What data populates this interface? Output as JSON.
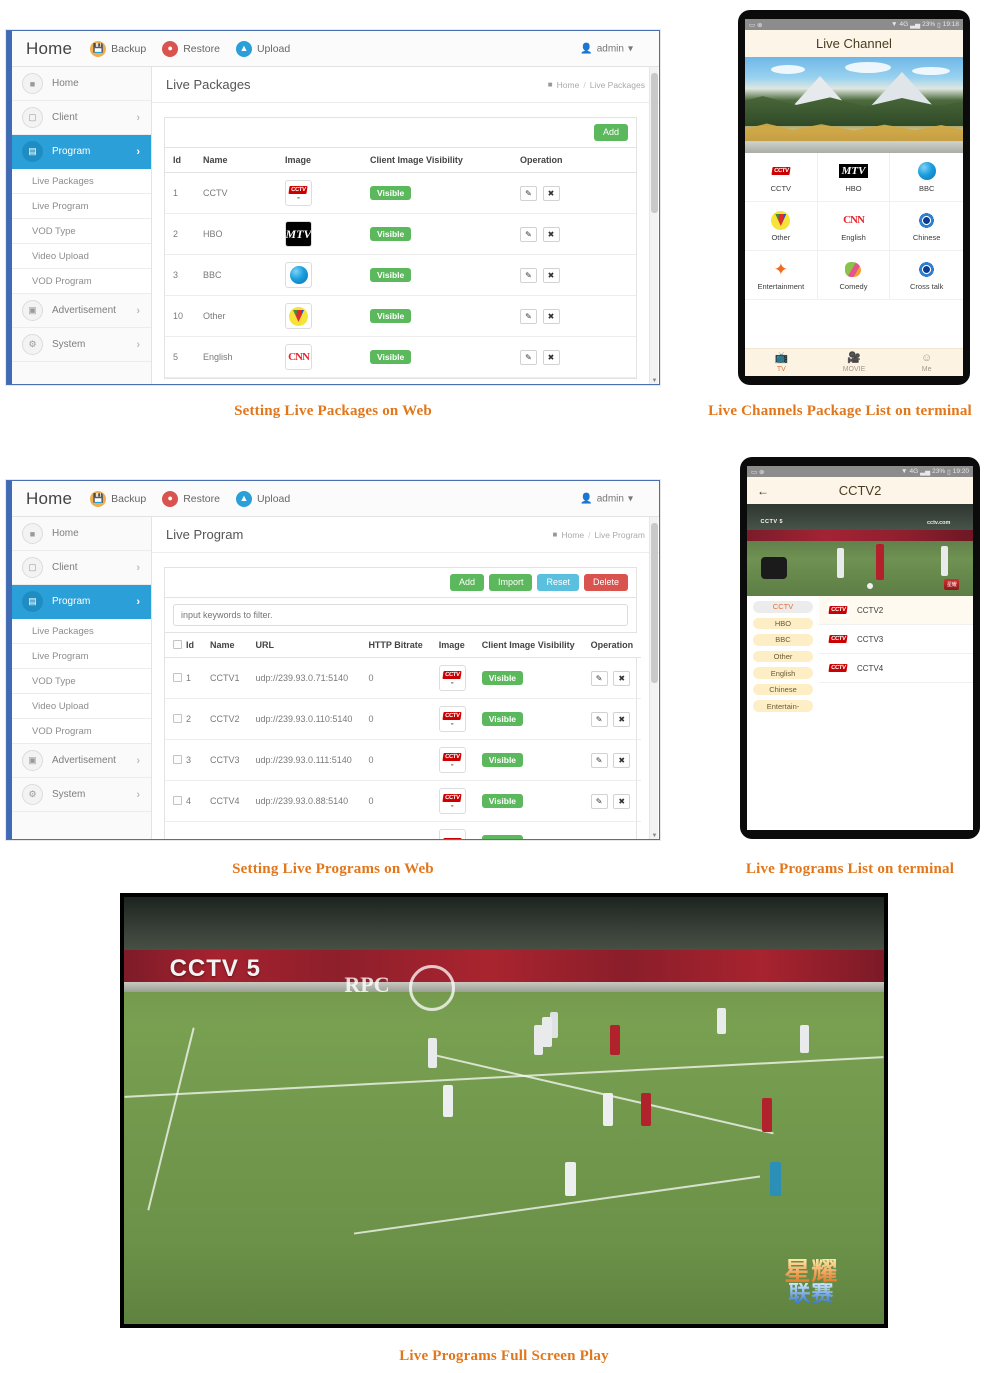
{
  "page": {
    "captions": {
      "fig1": "Setting Live Packages on Web",
      "fig2": "Live Channels Package List on terminal",
      "fig3": "Setting Live Programs on Web",
      "fig4": "Live Programs List on terminal",
      "fig5": "Live Programs Full Screen Play"
    },
    "accent_orange": "#E2761B"
  },
  "web": {
    "topbar": {
      "brand": "Home",
      "backup": "Backup",
      "restore": "Restore",
      "upload": "Upload",
      "user": "admin",
      "caret": "▾"
    },
    "sidebar": {
      "items": [
        {
          "label": "Home",
          "icon": "home-icon",
          "chevron": ""
        },
        {
          "label": "Client",
          "icon": "monitor-icon",
          "chevron": "›"
        },
        {
          "label": "Program",
          "icon": "database-icon",
          "chevron": "›"
        }
      ],
      "subitems": [
        "Live Packages",
        "Live Program",
        "VOD Type",
        "Video Upload",
        "VOD Program"
      ],
      "bottom": [
        {
          "label": "Advertisement",
          "icon": "image-icon",
          "chevron": "›"
        },
        {
          "label": "System",
          "icon": "gear-icon",
          "chevron": "›"
        }
      ]
    },
    "panel1": {
      "title": "Live Packages",
      "breadcrumb": {
        "home": "Home",
        "sep": "/",
        "current": "Live Packages"
      },
      "add_label": "Add",
      "columns": [
        "Id",
        "Name",
        "Image",
        "Client Image Visibility",
        "Operation"
      ],
      "rows": [
        {
          "id": "1",
          "name": "CCTV",
          "logo": "cctv-logo",
          "visibility": "Visible"
        },
        {
          "id": "2",
          "name": "HBO",
          "logo": "mtv-logo",
          "visibility": "Visible"
        },
        {
          "id": "3",
          "name": "BBC",
          "logo": "bbc-logo",
          "visibility": "Visible"
        },
        {
          "id": "10",
          "name": "Other",
          "logo": "other-logo",
          "visibility": "Visible"
        },
        {
          "id": "5",
          "name": "English",
          "logo": "cnn-logo",
          "visibility": "Visible"
        }
      ],
      "op_edit": "✎",
      "op_delete": "✖"
    },
    "panel2": {
      "title": "Live Program",
      "breadcrumb": {
        "home": "Home",
        "sep": "/",
        "current": "Live Program"
      },
      "buttons": {
        "add": "Add",
        "import": "Import",
        "reset": "Reset",
        "delete": "Delete"
      },
      "filter_placeholder": "input keywords to filter.",
      "columns": [
        "Id",
        "Name",
        "URL",
        "HTTP Bitrate",
        "Image",
        "Client Image Visibility",
        "Operation"
      ],
      "rows": [
        {
          "id": "1",
          "name": "CCTV1",
          "url": "udp://239.93.0.71:5140",
          "bitrate": "0",
          "logo": "cctv-logo",
          "visibility": "Visible"
        },
        {
          "id": "2",
          "name": "CCTV2",
          "url": "udp://239.93.0.110:5140",
          "bitrate": "0",
          "logo": "cctv-logo",
          "visibility": "Visible"
        },
        {
          "id": "3",
          "name": "CCTV3",
          "url": "udp://239.93.0.111:5140",
          "bitrate": "0",
          "logo": "cctv-logo",
          "visibility": "Visible"
        },
        {
          "id": "4",
          "name": "CCTV4",
          "url": "udp://239.93.0.88:5140",
          "bitrate": "0",
          "logo": "cctv-logo",
          "visibility": "Visible"
        }
      ],
      "op_edit": "✎",
      "op_delete": "✖"
    }
  },
  "tablet1": {
    "status": {
      "left_icons": "▭ ⊗",
      "signal": "▼",
      "network": "4G",
      "bars": "▃▅",
      "battery_pct": "23%",
      "battery_icon": "▯",
      "time": "19:18"
    },
    "title": "Live Channel",
    "channels": [
      {
        "label": "CCTV",
        "icon": "cctv-logo"
      },
      {
        "label": "HBO",
        "icon": "mtv-logo"
      },
      {
        "label": "BBC",
        "icon": "bbc-logo"
      },
      {
        "label": "Other",
        "icon": "other-logo"
      },
      {
        "label": "English",
        "icon": "cnn-logo"
      },
      {
        "label": "Chinese",
        "icon": "radar-logo"
      },
      {
        "label": "Entertainment",
        "icon": "star-logo"
      },
      {
        "label": "Comedy",
        "icon": "comedy-logo"
      },
      {
        "label": "Cross talk",
        "icon": "radar-logo"
      }
    ],
    "tabs": [
      {
        "label": "TV",
        "icon": "tv-icon",
        "active": true
      },
      {
        "label": "MOVIE",
        "icon": "film-icon",
        "active": false
      },
      {
        "label": "Me",
        "icon": "person-icon",
        "active": false
      }
    ]
  },
  "tablet2": {
    "status": {
      "left_icons": "▭ ⊗",
      "signal": "▼",
      "network": "4G",
      "bars": "▃▅",
      "battery_pct": "23%",
      "battery_icon": "▯",
      "time": "19:20"
    },
    "back_icon": "←",
    "title": "CCTV2",
    "video_overlay": {
      "left_logo": "CCTV 5",
      "right_logo": "cctv.com",
      "badge": "星耀"
    },
    "categories": [
      "CCTV",
      "HBO",
      "BBC",
      "Other",
      "English",
      "Chinese",
      "Entertain-"
    ],
    "selected_category": "CCTV",
    "programs": [
      {
        "name": "CCTV2",
        "icon": "cctv-logo",
        "selected": true
      },
      {
        "name": "CCTV3",
        "icon": "cctv-logo",
        "selected": false
      },
      {
        "name": "CCTV4",
        "icon": "cctv-logo",
        "selected": false
      }
    ]
  },
  "bigvideo": {
    "channel_logo": "CCTV 5",
    "sponsor_text": "RPC",
    "badge_line1": "星耀",
    "badge_line2": "联赛"
  }
}
